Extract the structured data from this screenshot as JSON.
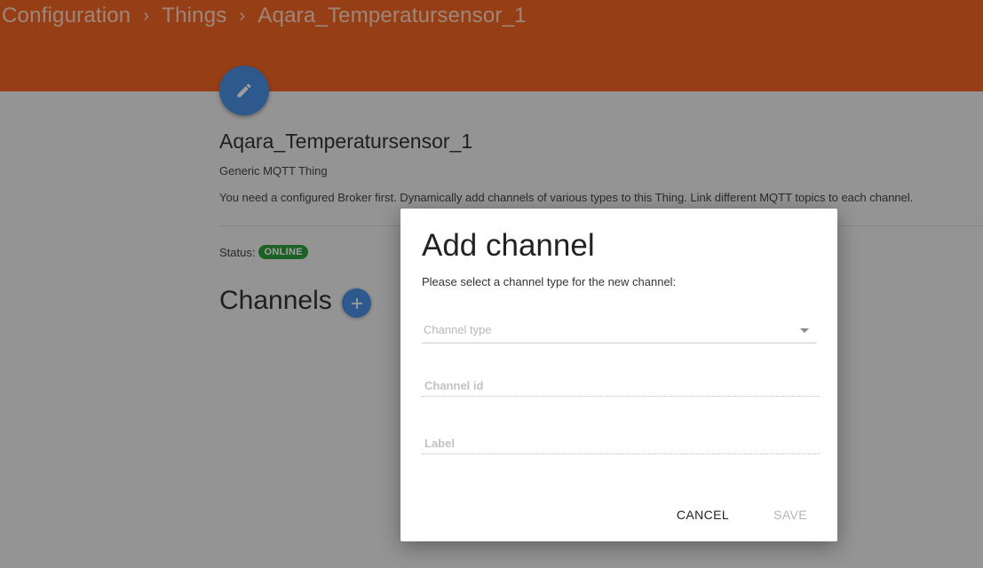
{
  "breadcrumb": {
    "items": [
      "Configuration",
      "Things",
      "Aqara_Temperatursensor_1"
    ],
    "separator": "›"
  },
  "thing": {
    "title": "Aqara_Temperatursensor_1",
    "type": "Generic MQTT Thing",
    "description": "You need a configured Broker first. Dynamically add channels of various types to this Thing. Link different MQTT topics to each channel.",
    "status_label": "Status:",
    "status_value": "ONLINE"
  },
  "channels": {
    "heading": "Channels"
  },
  "dialog": {
    "title": "Add channel",
    "subtitle": "Please select a channel type for the new channel:",
    "channel_type_placeholder": "Channel type",
    "channel_id_placeholder": "Channel id",
    "label_placeholder": "Label",
    "cancel_label": "CANCEL",
    "save_label": "SAVE"
  },
  "colors": {
    "header": "#f26522",
    "fab": "#4a90e2",
    "status_online": "#2e9e3f"
  },
  "icons": {
    "edit": "pencil-icon",
    "add": "plus-icon",
    "dropdown": "caret-down-icon"
  }
}
